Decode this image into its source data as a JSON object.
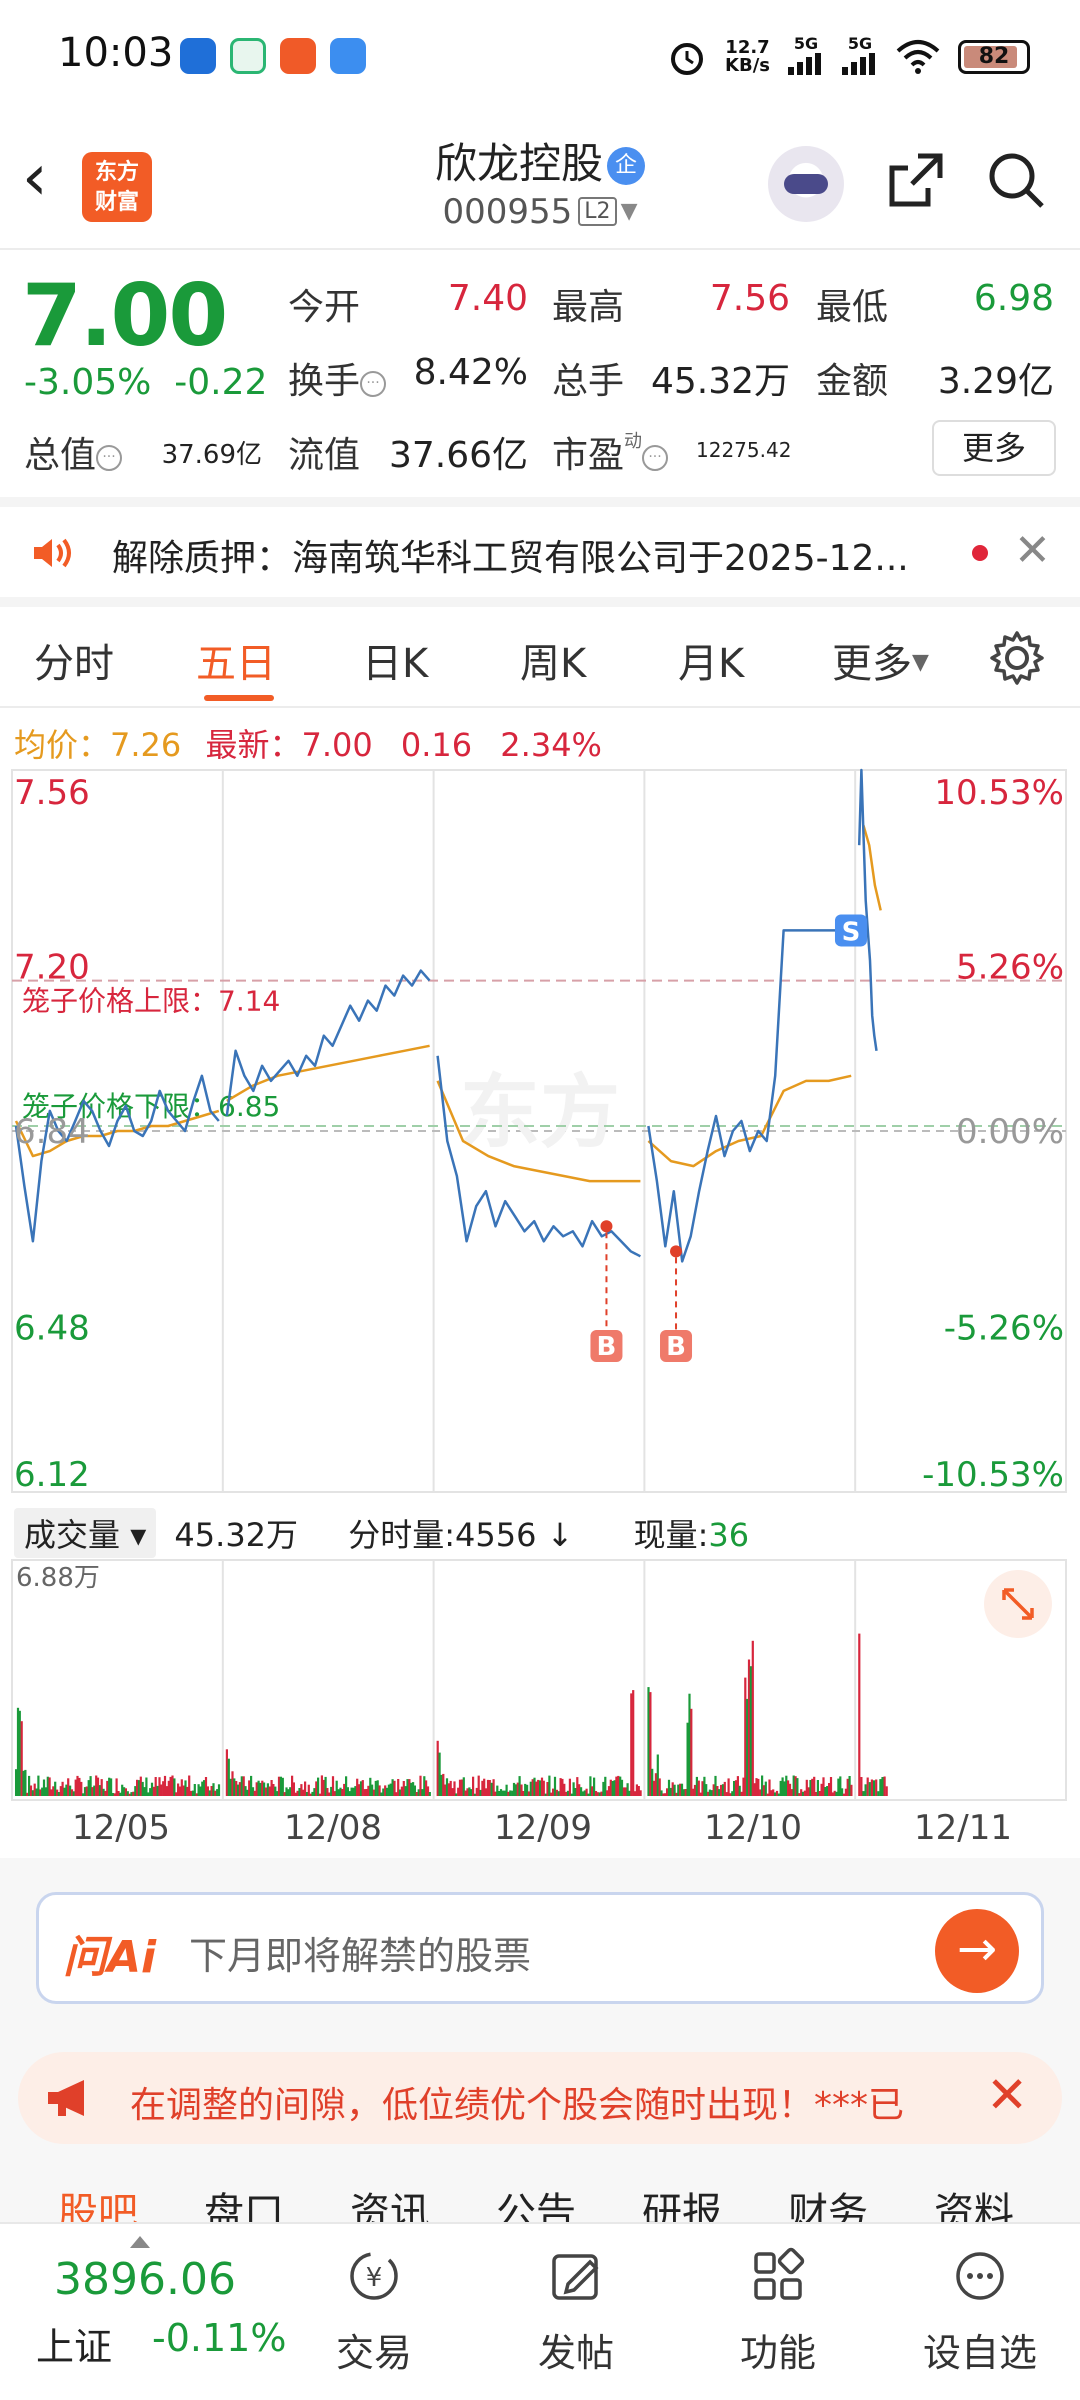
{
  "status_bar": {
    "time": "10:03",
    "net_speed_top": "12.7",
    "net_speed_bottom": "KB/s",
    "signal1": "5G",
    "signal2": "5G",
    "battery": "82"
  },
  "header": {
    "logo_text_1": "东方",
    "logo_text_2": "财富",
    "stock_name": "欣龙控股",
    "enterprise_badge": "企",
    "stock_code": "000955",
    "level_badge": "L2"
  },
  "quote": {
    "price": "7.00",
    "change_pct": "-3.05%",
    "change_abs": "-0.22",
    "open_label": "今开",
    "open_value": "7.40",
    "high_label": "最高",
    "high_value": "7.56",
    "low_label": "最低",
    "low_value": "6.98",
    "turnover_label": "换手",
    "turnover_value": "8.42%",
    "volume_label": "总手",
    "volume_value": "45.32万",
    "amount_label": "金额",
    "amount_value": "3.29亿",
    "mktcap_label": "总值",
    "mktcap_value": "37.69亿",
    "float_label": "流值",
    "float_value": "37.66亿",
    "pe_label": "市盈",
    "pe_sup": "动",
    "pe_value": "12275.42",
    "more_button": "更多"
  },
  "notice": {
    "text": "解除质押：海南筑华科工贸有限公司于2025-12..."
  },
  "tabs": {
    "items": [
      "分时",
      "五日",
      "日K",
      "周K",
      "月K",
      "更多"
    ],
    "active_index": 1
  },
  "price_info": {
    "avg_label": "均价：",
    "avg_value": "7.26",
    "latest_label": "最新：",
    "latest_value": "7.00",
    "latest_change": "0.16",
    "latest_pct": "2.34%"
  },
  "chart_data": {
    "type": "line",
    "title": "",
    "y_left_labels": [
      "7.56",
      "7.20",
      "6.84",
      "6.48",
      "6.12"
    ],
    "y_right_labels": [
      "10.53%",
      "5.26%",
      "0.00%",
      "-5.26%",
      "-10.53%"
    ],
    "ylim": [
      6.12,
      7.56
    ],
    "prev_close": 6.84,
    "cage_upper_label": "笼子价格上限：7.14",
    "cage_upper_value": 7.14,
    "cage_lower_label": "笼子价格下限：6.85",
    "cage_lower_value": 6.85,
    "x_labels": [
      "12/05",
      "12/08",
      "12/09",
      "12/10",
      "12/11"
    ],
    "price_series": [
      {
        "day": 0,
        "values": [
          6.85,
          6.73,
          6.62,
          6.78,
          6.88,
          6.84,
          6.82,
          6.86,
          6.9,
          6.88,
          6.84,
          6.81,
          6.86,
          6.89,
          6.84,
          6.83,
          6.86,
          6.92,
          6.88,
          6.86,
          6.84,
          6.9,
          6.95,
          6.88,
          6.86
        ]
      },
      {
        "day": 1,
        "values": [
          6.87,
          7.0,
          6.95,
          6.92,
          6.97,
          6.94,
          6.96,
          6.98,
          6.95,
          6.99,
          6.97,
          7.03,
          7.01,
          7.05,
          7.09,
          7.06,
          7.1,
          7.08,
          7.13,
          7.11,
          7.15,
          7.13,
          7.16,
          7.14
        ]
      },
      {
        "day": 2,
        "values": [
          6.99,
          6.82,
          6.75,
          6.62,
          6.69,
          6.72,
          6.65,
          6.7,
          6.67,
          6.64,
          6.66,
          6.62,
          6.65,
          6.63,
          6.64,
          6.61,
          6.66,
          6.63,
          6.64,
          6.62,
          6.6,
          6.59
        ]
      },
      {
        "day": 3,
        "values": [
          6.85,
          6.74,
          6.61,
          6.72,
          6.58,
          6.63,
          6.72,
          6.8,
          6.87,
          6.79,
          6.84,
          6.86,
          6.8,
          6.84,
          6.82,
          6.95,
          7.24,
          7.24,
          7.24,
          7.24,
          7.24,
          7.24,
          7.24,
          7.24,
          7.24
        ]
      },
      {
        "day": 4,
        "values": [
          7.41,
          7.56,
          7.43,
          7.3,
          7.24,
          7.18,
          7.07,
          7.03,
          7.0
        ]
      }
    ],
    "avg_series": [
      {
        "day": 0,
        "values": [
          6.86,
          6.79,
          6.8,
          6.82,
          6.83,
          6.83,
          6.84,
          6.84,
          6.85,
          6.85,
          6.86,
          6.87,
          6.88
        ]
      },
      {
        "day": 1,
        "values": [
          6.9,
          6.93,
          6.95,
          6.96,
          6.97,
          6.98,
          6.99,
          7.0,
          7.01
        ]
      },
      {
        "day": 2,
        "values": [
          6.94,
          6.82,
          6.79,
          6.77,
          6.76,
          6.75,
          6.74,
          6.74,
          6.74
        ]
      },
      {
        "day": 3,
        "values": [
          6.82,
          6.78,
          6.77,
          6.8,
          6.82,
          6.83,
          6.92,
          6.94,
          6.94,
          6.95
        ]
      },
      {
        "day": 4,
        "values": [
          7.45,
          7.41,
          7.33,
          7.28
        ]
      }
    ],
    "markers": [
      {
        "label": "B",
        "day": 2,
        "pos": 0.82,
        "price": 6.65
      },
      {
        "label": "B",
        "day": 3,
        "pos": 0.15,
        "price": 6.6
      },
      {
        "label": "S",
        "day": 3,
        "pos": 0.98,
        "price": 7.24
      }
    ],
    "volume": {
      "max_label": "6.88万",
      "header_label": "成交量",
      "total": "45.32万",
      "tick_label": "分时量:4556",
      "tick_arrow": "↓",
      "now_label": "现量:",
      "now_value": "36"
    }
  },
  "ai": {
    "logo": "问Ai",
    "placeholder": "下月即将解禁的股票"
  },
  "promo": {
    "text": "在调整的间隙，低位绩优个股会随时出现！***已"
  },
  "sub_tabs": [
    "股吧",
    "盘口",
    "资讯",
    "公告",
    "研报",
    "财务",
    "资料"
  ],
  "bottom_bar": {
    "index_value": "3896.06",
    "index_name": "上证",
    "index_change": "-0.11%",
    "items": [
      "交易",
      "发帖",
      "功能",
      "设自选"
    ]
  },
  "colors": {
    "accent": "#f25c26",
    "up": "#d7263d",
    "down": "#1a9a3a",
    "price_line": "#3a74b8",
    "avg_line": "#e59a1f"
  }
}
